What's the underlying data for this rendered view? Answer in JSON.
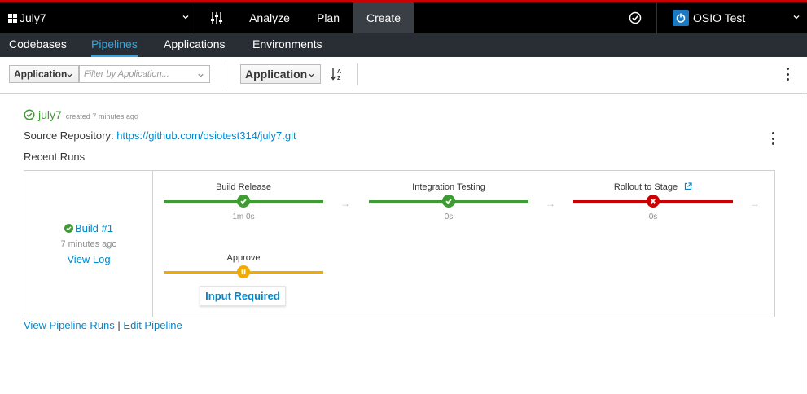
{
  "topnav": {
    "space_name": "July7",
    "items": [
      "Analyze",
      "Plan",
      "Create"
    ],
    "active": "Create",
    "user_name": "OSIO Test"
  },
  "subnav": {
    "items": [
      "Codebases",
      "Pipelines",
      "Applications",
      "Environments"
    ],
    "active": "Pipelines"
  },
  "toolbar": {
    "filter_field": "Application",
    "filter_placeholder": "Filter by Application...",
    "sort_field": "Application"
  },
  "pipeline": {
    "name": "july7",
    "created": "created 7 minutes ago",
    "source_label": "Source Repository:",
    "source_url": "https://github.com/osiotest314/july7.git",
    "recent_runs_label": "Recent Runs",
    "build": {
      "name": "Build #1",
      "time": "7 minutes ago",
      "view_log": "View Log"
    },
    "stages": [
      {
        "label": "Build Release",
        "duration": "1m 0s",
        "status": "success"
      },
      {
        "label": "Integration Testing",
        "duration": "0s",
        "status": "success"
      },
      {
        "label": "Rollout to Stage",
        "duration": "0s",
        "status": "failed"
      },
      {
        "label": "Approve",
        "duration": "",
        "status": "paused"
      }
    ],
    "input_required": "Input Required",
    "view_runs": "View Pipeline Runs",
    "separator": "|",
    "edit": "Edit Pipeline"
  },
  "colors": {
    "success": "#3f9c35",
    "failed": "#cc0000",
    "paused": "#f0ab00",
    "link": "#0088ce",
    "accent_top": "#cc0000"
  }
}
